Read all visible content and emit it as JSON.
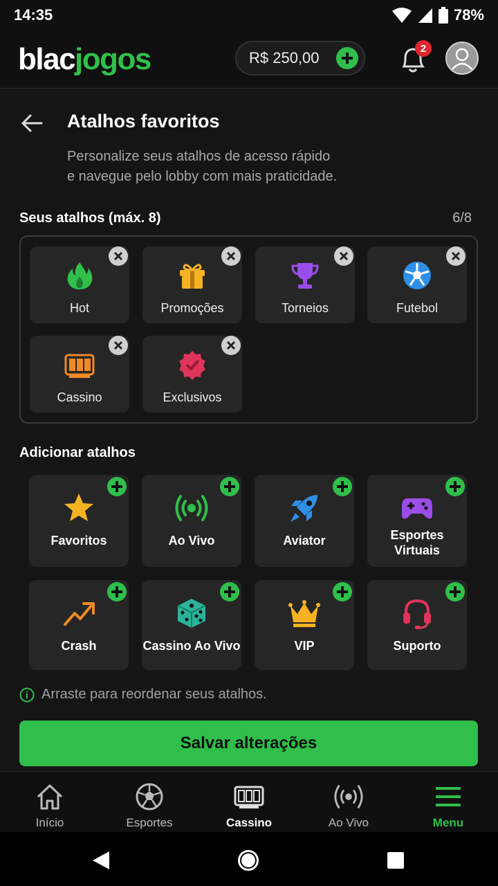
{
  "status": {
    "time": "14:35",
    "battery": "78%"
  },
  "header": {
    "logo_white": "blac",
    "logo_green": "jogos",
    "balance": "R$ 250,00",
    "notifications": "2"
  },
  "page": {
    "title": "Atalhos favoritos",
    "subtitle_line1": "Personalize seus atalhos de acesso rápido",
    "subtitle_line2": "e navegue pelo lobby com mais praticidade.",
    "my_shortcuts_label": "Seus atalhos (máx. 8)",
    "count": "6/8",
    "add_label": "Adicionar atalhos",
    "hint": "Arraste para reordenar seus atalhos.",
    "save": "Salvar alterações"
  },
  "favorites": [
    {
      "label": "Hot",
      "icon": "flame-icon"
    },
    {
      "label": "Promoções",
      "icon": "gift-icon"
    },
    {
      "label": "Torneios",
      "icon": "trophy-icon"
    },
    {
      "label": "Futebol",
      "icon": "soccer-ball-icon"
    },
    {
      "label": "Cassino",
      "icon": "slot-machine-icon"
    },
    {
      "label": "Exclusivos",
      "icon": "exclusive-badge-icon"
    }
  ],
  "available": [
    {
      "label": "Favoritos",
      "icon": "star-icon"
    },
    {
      "label": "Ao Vivo",
      "icon": "live-broadcast-icon"
    },
    {
      "label": "Aviator",
      "icon": "rocket-icon"
    },
    {
      "label_line1": "Esportes",
      "label_line2": "Virtuais",
      "icon": "gamepad-icon"
    },
    {
      "label": "Crash",
      "icon": "trend-up-icon"
    },
    {
      "label": "Cassino Ao Vivo",
      "icon": "dice-icon"
    },
    {
      "label": "VIP",
      "icon": "crown-icon"
    },
    {
      "label": "Suporto",
      "icon": "headset-icon"
    }
  ],
  "nav": [
    {
      "label": "Início",
      "icon": "home-icon"
    },
    {
      "label": "Esportes",
      "icon": "soccer-ball-icon"
    },
    {
      "label": "Cassino",
      "icon": "slot-machine-icon"
    },
    {
      "label": "Ao Vivo",
      "icon": "live-broadcast-icon"
    },
    {
      "label": "Menu",
      "icon": "menu-icon"
    }
  ],
  "colors": {
    "accent": "#2fbf4a",
    "background": "#151515",
    "tile": "#262626",
    "badge": "#e0262f"
  }
}
